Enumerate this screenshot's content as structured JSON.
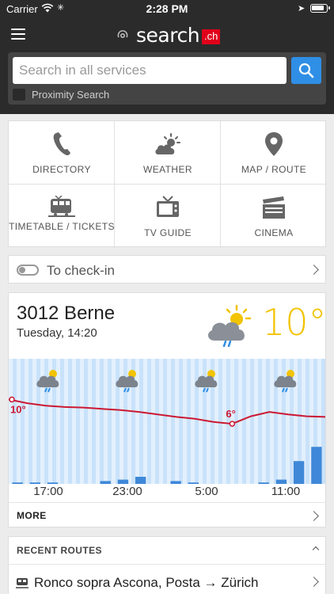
{
  "status": {
    "carrier": "Carrier",
    "time": "2:28 PM"
  },
  "header": {
    "logo_word": "search",
    "logo_tld": ".ch",
    "brand_color": "#e0001a"
  },
  "search": {
    "placeholder": "Search in all services",
    "proximity_label": "Proximity Search",
    "button_color": "#2f8fe6"
  },
  "services": [
    {
      "label": "DIRECTORY",
      "icon": "phone-icon"
    },
    {
      "label": "WEATHER",
      "icon": "weather-icon"
    },
    {
      "label": "MAP / ROUTE",
      "icon": "map-pin-icon"
    },
    {
      "label": "TIMETABLE / TICKETS",
      "icon": "train-icon"
    },
    {
      "label": "TV GUIDE",
      "icon": "tv-icon"
    },
    {
      "label": "CINEMA",
      "icon": "clapperboard-icon"
    }
  ],
  "checkin": {
    "label": "To check-in"
  },
  "weather": {
    "location": "3012 Berne",
    "datetime": "Tuesday, 14:20",
    "temperature": "10°",
    "icon": "rain-sun-cloud-icon",
    "more_label": "MORE",
    "chart_data": {
      "type": "line",
      "x_ticks": [
        "17:00",
        "23:00",
        "5:00",
        "11:00"
      ],
      "temperature_labels": [
        "10°",
        "6°"
      ],
      "temperature": [
        10,
        9.4,
        9.0,
        8.8,
        8.7,
        8.5,
        8.3,
        8.0,
        7.6,
        7.2,
        6.9,
        6.4,
        6.1,
        7.3,
        8.0,
        7.6,
        7.3,
        7.2
      ],
      "precipitation": [
        0.1,
        0.1,
        0.1,
        0,
        0,
        0.2,
        0.3,
        0.5,
        0,
        0.2,
        0.1,
        0,
        0,
        0,
        0.1,
        0.3,
        1.6,
        2.6
      ],
      "line_color": "#cc1833"
    }
  },
  "routes": {
    "header": "RECENT ROUTES",
    "items": [
      {
        "label": "Ronco sopra Ascona, Posta → Zürich"
      }
    ]
  }
}
